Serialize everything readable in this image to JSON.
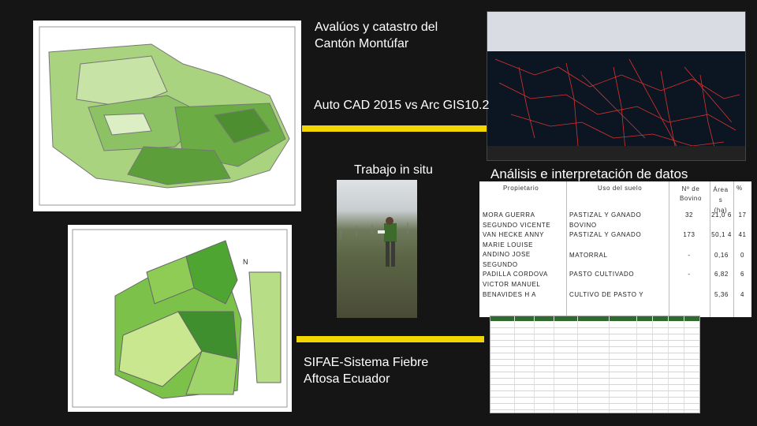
{
  "captions": {
    "top_title": "Avalúos y catastro del Cantón Montúfar",
    "autocad": "Auto CAD 2015 vs Arc GIS10.2",
    "trabajo": "Trabajo in situ",
    "analisis": "Análisis e interpretación de datos",
    "sifae": "SIFAE-Sistema Fiebre Aftosa Ecuador"
  },
  "table": {
    "headers": [
      "Propietario",
      "Uso del suelo",
      "Nº de Bovino",
      "Área s (ha)",
      "%"
    ],
    "rows": [
      {
        "owner": "MORA GUERRA SEGUNDO VICENTE",
        "use": "PASTIZAL Y GANADO BOVINO",
        "bovinos": "32",
        "area": "21,0 6",
        "pct": "17"
      },
      {
        "owner": "VAN HECKE ANNY MARIE LOUISE",
        "use": "PASTIZAL Y GANADO",
        "bovinos": "173",
        "area": "50,1 4",
        "pct": "41"
      },
      {
        "owner": "ANDINO JOSE SEGUNDO",
        "use": "MATORRAL",
        "bovinos": "-",
        "area": "0,16",
        "pct": "0"
      },
      {
        "owner": "PADILLA CORDOVA VICTOR MANUEL",
        "use": "PASTO CULTIVADO",
        "bovinos": "-",
        "area": "6,82",
        "pct": "6"
      },
      {
        "owner": "BENAVIDES H A",
        "use": "CULTIVO DE PASTO Y",
        "bovinos": "",
        "area": "5,36",
        "pct": "4"
      }
    ]
  },
  "colors": {
    "background": "#151515",
    "accent_bar": "#f2d600",
    "map_green_dark": "#3f8f2e",
    "map_green_light": "#b7dd86"
  }
}
